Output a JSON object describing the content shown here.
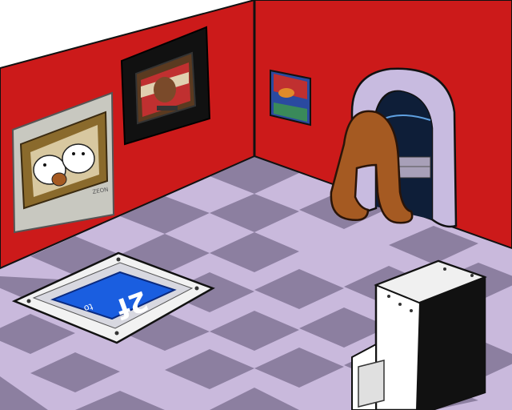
{
  "scene": {
    "name": "game-room",
    "colors": {
      "wall": "#cc1a1a",
      "floor_light": "#c9b9dc",
      "floor_dark": "#8c7fa0",
      "outline": "#111111",
      "door_frame": "#c8bbe0",
      "creature": "#a55a22",
      "mat_blue": "#1a5ee0",
      "frame_gold": "#8a6a2c"
    }
  },
  "floor_mat": {
    "logo_text": "2f",
    "logo_small": "to"
  },
  "painting_bears": {
    "signature": "ZEON"
  },
  "icons": {
    "door": "arched-doorway-icon",
    "creature": "brown-creature-icon",
    "cabinet": "white-cabinet-icon"
  }
}
